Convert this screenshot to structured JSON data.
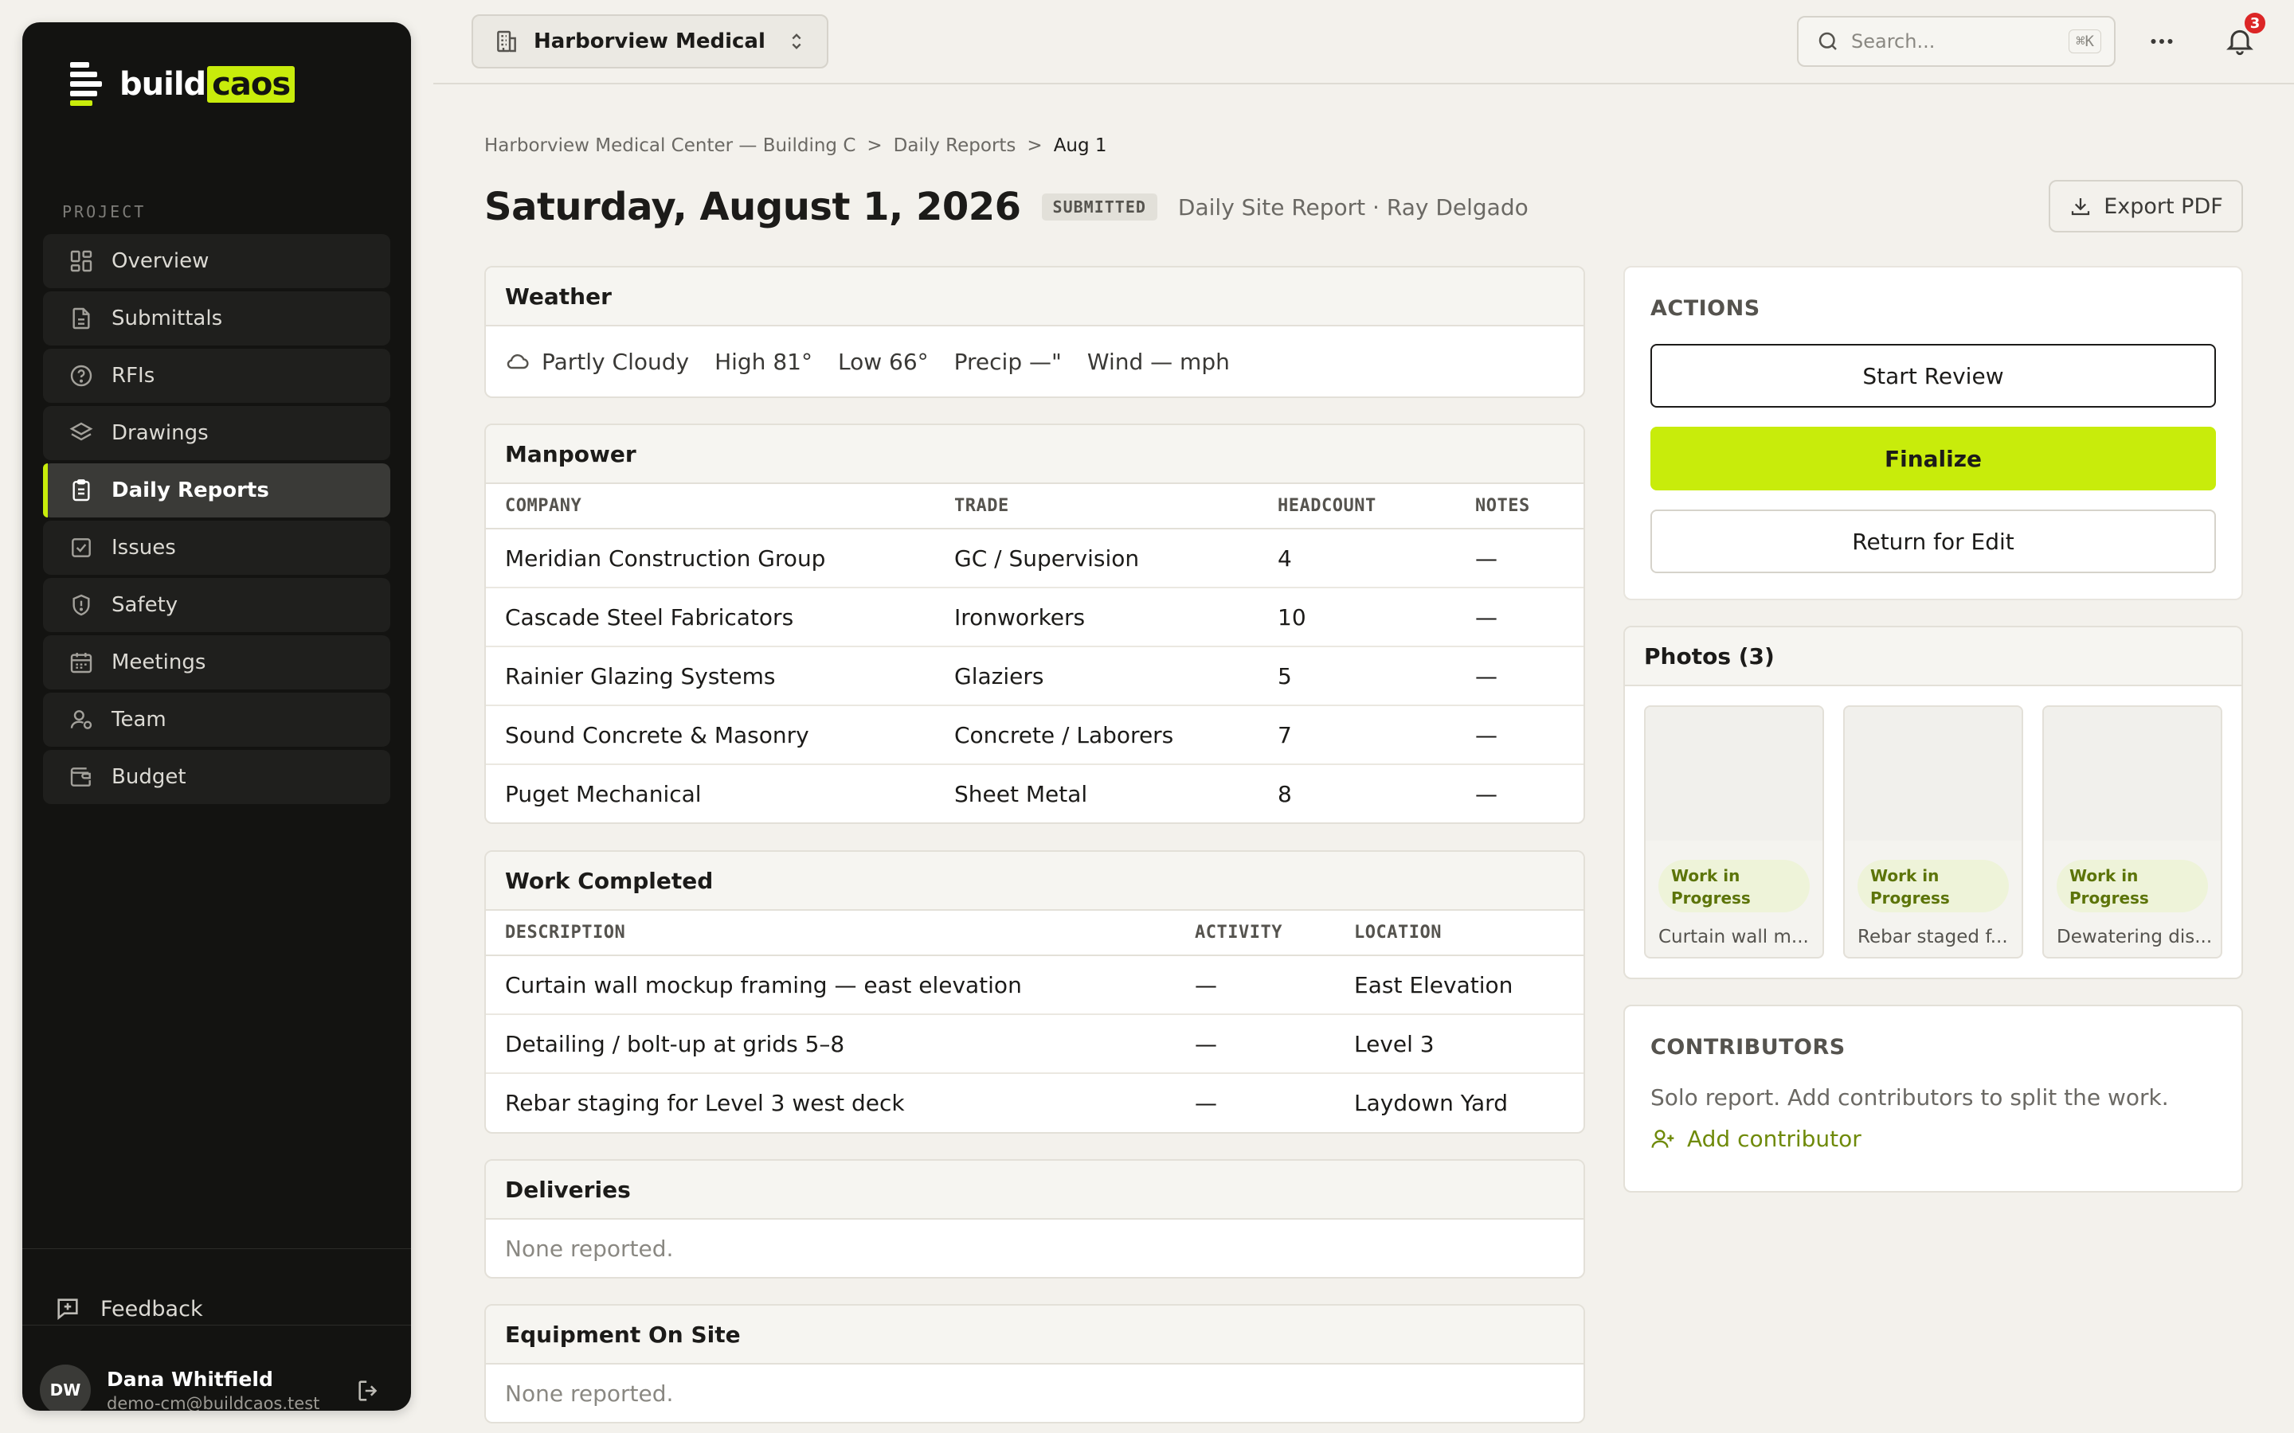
{
  "brand": {
    "name": "build",
    "highlight": "caos"
  },
  "sidebar": {
    "section_label": "PROJECT",
    "items": [
      {
        "label": "Overview",
        "icon": "dashboard-icon"
      },
      {
        "label": "Submittals",
        "icon": "document-icon"
      },
      {
        "label": "RFIs",
        "icon": "question-icon"
      },
      {
        "label": "Drawings",
        "icon": "layers-icon"
      },
      {
        "label": "Daily Reports",
        "icon": "clipboard-icon",
        "active": true
      },
      {
        "label": "Issues",
        "icon": "checkbox-icon"
      },
      {
        "label": "Safety",
        "icon": "shield-icon"
      },
      {
        "label": "Meetings",
        "icon": "calendar-icon"
      },
      {
        "label": "Team",
        "icon": "user-icon"
      },
      {
        "label": "Budget",
        "icon": "wallet-icon"
      }
    ],
    "feedback_label": "Feedback",
    "user": {
      "initials": "DW",
      "name": "Dana Whitfield",
      "email": "demo-cm@buildcaos.test"
    }
  },
  "topbar": {
    "project_select": "Harborview Medical C...",
    "search_placeholder": "Search...",
    "search_shortcut": "⌘K",
    "notification_count": "3"
  },
  "breadcrumb": {
    "items": [
      "Harborview Medical Center — Building C",
      "Daily Reports"
    ],
    "current": "Aug 1"
  },
  "header": {
    "title": "Saturday, August 1, 2026",
    "status": "SUBMITTED",
    "subtitle": "Daily Site Report · Ray Delgado",
    "export_label": "Export PDF"
  },
  "weather": {
    "title": "Weather",
    "condition": "Partly Cloudy",
    "high": "High 81°",
    "low": "Low 66°",
    "precip": "Precip —\"",
    "wind": "Wind — mph"
  },
  "manpower": {
    "title": "Manpower",
    "columns": [
      "COMPANY",
      "TRADE",
      "HEADCOUNT",
      "NOTES"
    ],
    "rows": [
      [
        "Meridian Construction Group",
        "GC / Supervision",
        "4",
        "—"
      ],
      [
        "Cascade Steel Fabricators",
        "Ironworkers",
        "10",
        "—"
      ],
      [
        "Rainier Glazing Systems",
        "Glaziers",
        "5",
        "—"
      ],
      [
        "Sound Concrete & Masonry",
        "Concrete / Laborers",
        "7",
        "—"
      ],
      [
        "Puget Mechanical",
        "Sheet Metal",
        "8",
        "—"
      ]
    ]
  },
  "work_completed": {
    "title": "Work Completed",
    "columns": [
      "DESCRIPTION",
      "ACTIVITY",
      "LOCATION"
    ],
    "rows": [
      [
        "Curtain wall mockup framing — east elevation",
        "—",
        "East Elevation"
      ],
      [
        "Detailing / bolt-up at grids 5–8",
        "—",
        "Level 3"
      ],
      [
        "Rebar staging for Level 3 west deck",
        "—",
        "Laydown Yard"
      ]
    ]
  },
  "deliveries": {
    "title": "Deliveries",
    "empty": "None reported."
  },
  "equipment": {
    "title": "Equipment On Site",
    "empty": "None reported."
  },
  "actions": {
    "label": "ACTIONS",
    "start_review": "Start Review",
    "finalize": "Finalize",
    "return_for_edit": "Return for Edit"
  },
  "photos": {
    "title": "Photos (3)",
    "items": [
      {
        "tag_line1": "Work in",
        "tag_line2": "Progress",
        "caption": "Curtain wall m..."
      },
      {
        "tag_line1": "Work in",
        "tag_line2": "Progress",
        "caption": "Rebar staged f..."
      },
      {
        "tag_line1": "Work in",
        "tag_line2": "Progress",
        "caption": "Dewatering dis..."
      }
    ]
  },
  "contributors": {
    "label": "CONTRIBUTORS",
    "text": "Solo report. Add contributors to split the work.",
    "add_label": "Add contributor"
  },
  "colors": {
    "accent": "#c8ec0b",
    "sidebar_bg": "#131311",
    "page_bg": "#f3f1ec",
    "badge_red": "#dc2626"
  }
}
